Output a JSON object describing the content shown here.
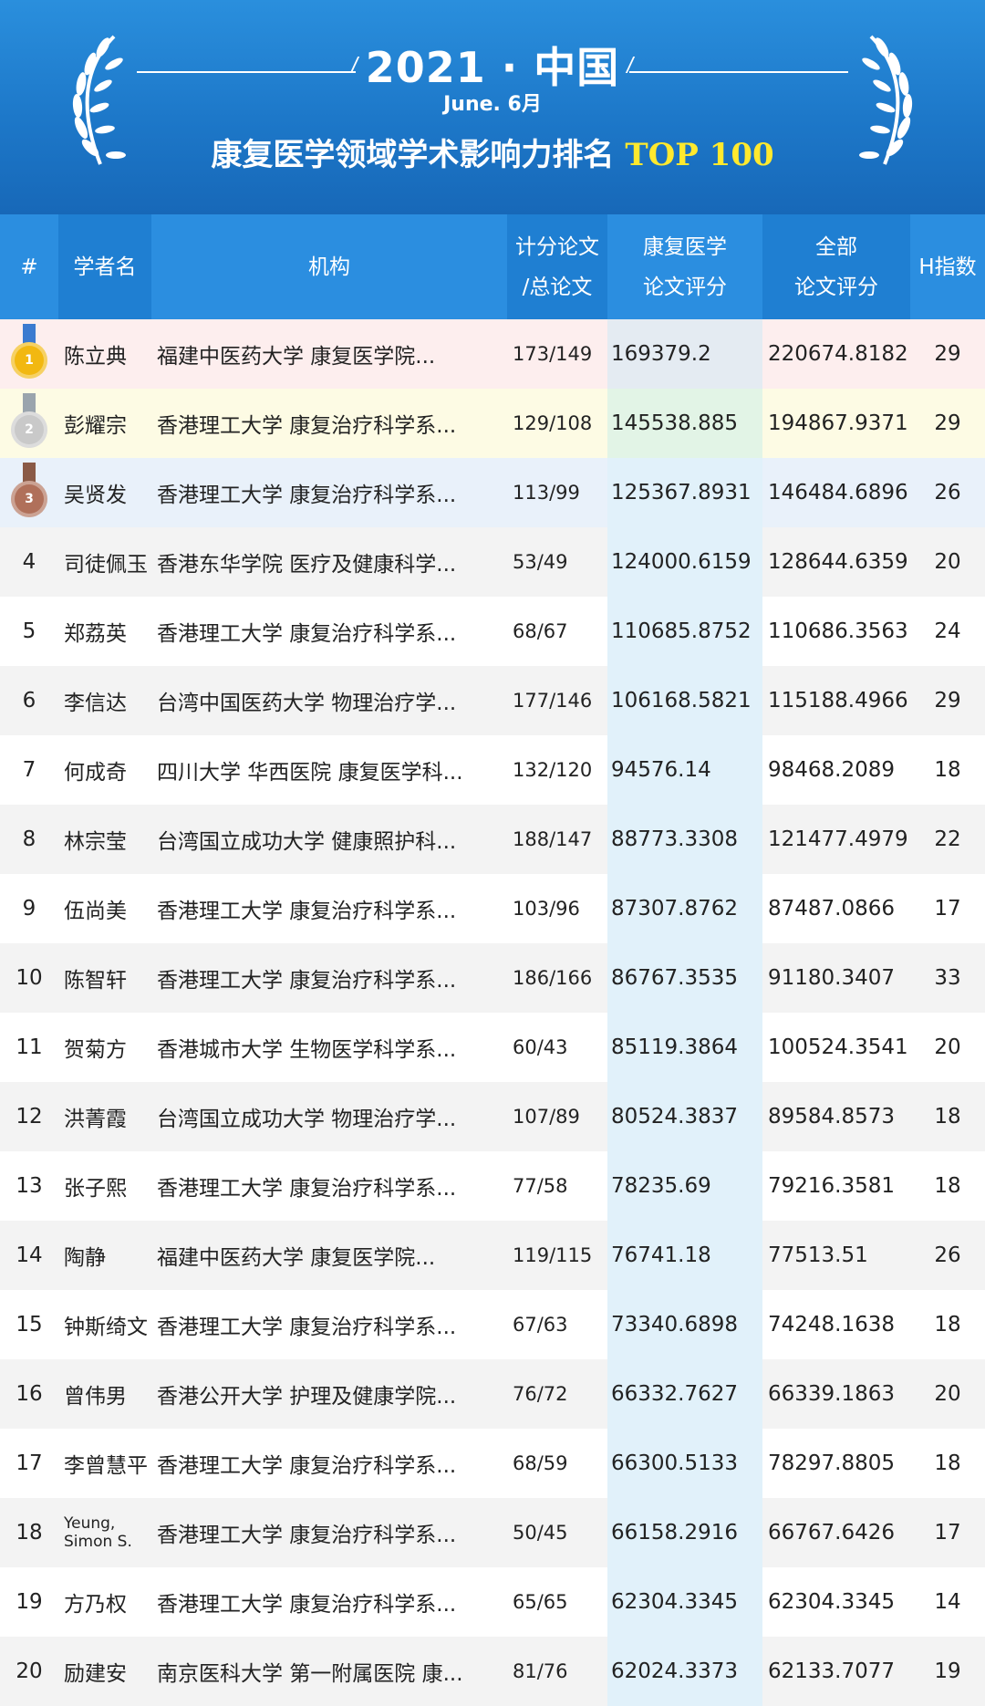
{
  "header": {
    "title": "2021 · 中国",
    "subtitle": "June.  6月",
    "headline": "康复医学领域学术影响力排名",
    "headline_highlight": "TOP 100"
  },
  "columns": {
    "rank": "#",
    "name": "学者名",
    "org": "机构",
    "papers_1": "计分论文",
    "papers_2": "/总论文",
    "rehab_1": "康复医学",
    "rehab_2": "论文评分",
    "all_1": "全部",
    "all_2": "论文评分",
    "h": "H指数"
  },
  "colors": {
    "header_bg": "#2b8ee0",
    "highlight": "#ffe92e",
    "gold": "#f2b811",
    "silver": "#c9c9c9",
    "bronze": "#b0705a"
  },
  "medals": [
    "gold-medal-icon",
    "silver-medal-icon",
    "bronze-medal-icon"
  ],
  "rows": [
    {
      "rank": "1",
      "name": "陈立典",
      "org": "福建中医药大学 康复医学院...",
      "papers": "173/149",
      "rehab": "169379.2",
      "all": "220674.8182",
      "h": "29"
    },
    {
      "rank": "2",
      "name": "彭耀宗",
      "org": "香港理工大学 康复治疗科学系...",
      "papers": "129/108",
      "rehab": "145538.885",
      "all": "194867.9371",
      "h": "29"
    },
    {
      "rank": "3",
      "name": "吴贤发",
      "org": "香港理工大学 康复治疗科学系...",
      "papers": "113/99",
      "rehab": "125367.8931",
      "all": "146484.6896",
      "h": "26"
    },
    {
      "rank": "4",
      "name": "司徒佩玉",
      "org": "香港东华学院 医疗及健康科学...",
      "papers": "53/49",
      "rehab": "124000.6159",
      "all": "128644.6359",
      "h": "20"
    },
    {
      "rank": "5",
      "name": "郑荔英",
      "org": "香港理工大学 康复治疗科学系...",
      "papers": "68/67",
      "rehab": "110685.8752",
      "all": "110686.3563",
      "h": "24"
    },
    {
      "rank": "6",
      "name": "李信达",
      "org": "台湾中国医药大学 物理治疗学...",
      "papers": "177/146",
      "rehab": "106168.5821",
      "all": "115188.4966",
      "h": "29"
    },
    {
      "rank": "7",
      "name": "何成奇",
      "org": "四川大学 华西医院 康复医学科...",
      "papers": "132/120",
      "rehab": "94576.14",
      "all": "98468.2089",
      "h": "18"
    },
    {
      "rank": "8",
      "name": "林宗莹",
      "org": "台湾国立成功大学 健康照护科...",
      "papers": "188/147",
      "rehab": "88773.3308",
      "all": "121477.4979",
      "h": "22"
    },
    {
      "rank": "9",
      "name": "伍尚美",
      "org": "香港理工大学 康复治疗科学系...",
      "papers": "103/96",
      "rehab": "87307.8762",
      "all": "87487.0866",
      "h": "17"
    },
    {
      "rank": "10",
      "name": "陈智轩",
      "org": "香港理工大学 康复治疗科学系...",
      "papers": "186/166",
      "rehab": "86767.3535",
      "all": "91180.3407",
      "h": "33"
    },
    {
      "rank": "11",
      "name": "贺菊方",
      "org": "香港城市大学 生物医学科学系...",
      "papers": "60/43",
      "rehab": "85119.3864",
      "all": "100524.3541",
      "h": "20"
    },
    {
      "rank": "12",
      "name": "洪菁霞",
      "org": "台湾国立成功大学 物理治疗学...",
      "papers": "107/89",
      "rehab": "80524.3837",
      "all": "89584.8573",
      "h": "18"
    },
    {
      "rank": "13",
      "name": "张子熙",
      "org": "香港理工大学 康复治疗科学系...",
      "papers": "77/58",
      "rehab": "78235.69",
      "all": "79216.3581",
      "h": "18"
    },
    {
      "rank": "14",
      "name": "陶静",
      "org": "福建中医药大学 康复医学院...",
      "papers": "119/115",
      "rehab": "76741.18",
      "all": "77513.51",
      "h": "26"
    },
    {
      "rank": "15",
      "name": "钟斯绮文",
      "org": "香港理工大学 康复治疗科学系...",
      "papers": "67/63",
      "rehab": "73340.6898",
      "all": "74248.1638",
      "h": "18"
    },
    {
      "rank": "16",
      "name": "曾伟男",
      "org": "香港公开大学 护理及健康学院...",
      "papers": "76/72",
      "rehab": "66332.7627",
      "all": "66339.1863",
      "h": "20"
    },
    {
      "rank": "17",
      "name": "李曾慧平",
      "org": "香港理工大学 康复治疗科学系...",
      "papers": "68/59",
      "rehab": "66300.5133",
      "all": "78297.8805",
      "h": "18"
    },
    {
      "rank": "18",
      "name": "Yeung, Simon S.",
      "org": "香港理工大学 康复治疗科学系...",
      "papers": "50/45",
      "rehab": "66158.2916",
      "all": "66767.6426",
      "h": "17"
    },
    {
      "rank": "19",
      "name": "方乃权",
      "org": "香港理工大学 康复治疗科学系...",
      "papers": "65/65",
      "rehab": "62304.3345",
      "all": "62304.3345",
      "h": "14"
    },
    {
      "rank": "20",
      "name": "励建安",
      "org": "南京医科大学 第一附属医院 康...",
      "papers": "81/76",
      "rehab": "62024.3373",
      "all": "62133.7077",
      "h": "19"
    }
  ]
}
